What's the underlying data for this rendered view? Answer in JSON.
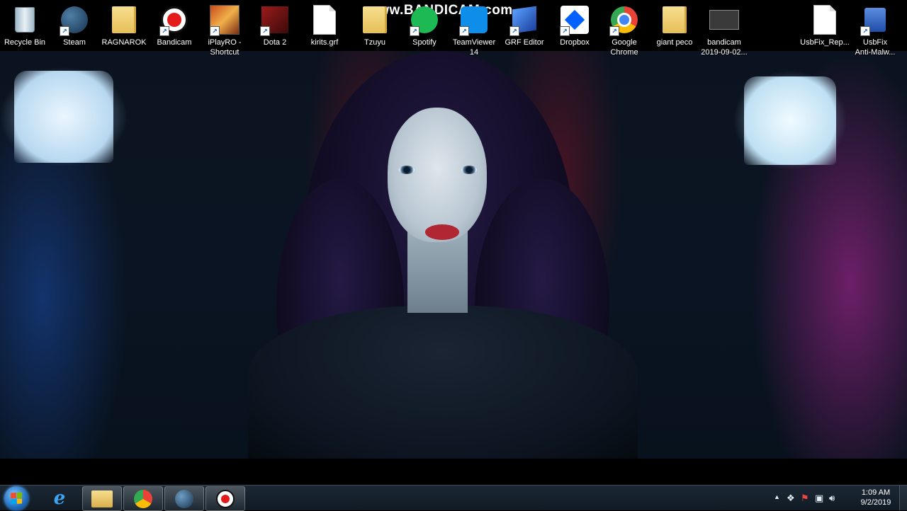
{
  "watermark": "www.BANDICAM.com",
  "desktop_icons": [
    {
      "label": "Recycle Bin",
      "icon": "recycle-bin-icon"
    },
    {
      "label": "Steam",
      "icon": "steam-icon"
    },
    {
      "label": "RAGNAROK",
      "icon": "folder-icon"
    },
    {
      "label": "Bandicam",
      "icon": "bandicam-icon"
    },
    {
      "label": "iPlayRO -\nShortcut",
      "icon": "iplayro-icon"
    },
    {
      "label": "Dota 2",
      "icon": "dota2-icon"
    },
    {
      "label": "kirits.grf",
      "icon": "file-icon"
    },
    {
      "label": "Tzuyu",
      "icon": "folder-icon"
    },
    {
      "label": "Spotify",
      "icon": "spotify-icon"
    },
    {
      "label": "TeamViewer\n14",
      "icon": "teamviewer-icon"
    },
    {
      "label": "GRF Editor",
      "icon": "grf-editor-icon"
    },
    {
      "label": "Dropbox",
      "icon": "dropbox-icon"
    },
    {
      "label": "Google\nChrome",
      "icon": "chrome-icon"
    },
    {
      "label": "giant peco",
      "icon": "folder-icon"
    },
    {
      "label": "bandicam\n2019-09-02...",
      "icon": "video-file-icon"
    },
    {
      "label": "UsbFix_Rep...",
      "icon": "text-file-icon"
    },
    {
      "label": "UsbFix\nAnti-Malw...",
      "icon": "usbfix-icon"
    }
  ],
  "taskbar": {
    "pinned": [
      {
        "name": "internet-explorer",
        "icon": "ie-icon"
      },
      {
        "name": "file-explorer",
        "icon": "folder-icon"
      },
      {
        "name": "chrome",
        "icon": "chrome-icon"
      },
      {
        "name": "steam",
        "icon": "steam-icon"
      },
      {
        "name": "bandicam",
        "icon": "bandicam-icon"
      }
    ],
    "clock_time": "1:09 AM",
    "clock_date": "9/2/2019",
    "tray_expand": "▲"
  },
  "colors": {
    "taskbar": "#1c2834",
    "accent_start": "#1f6bbd"
  }
}
